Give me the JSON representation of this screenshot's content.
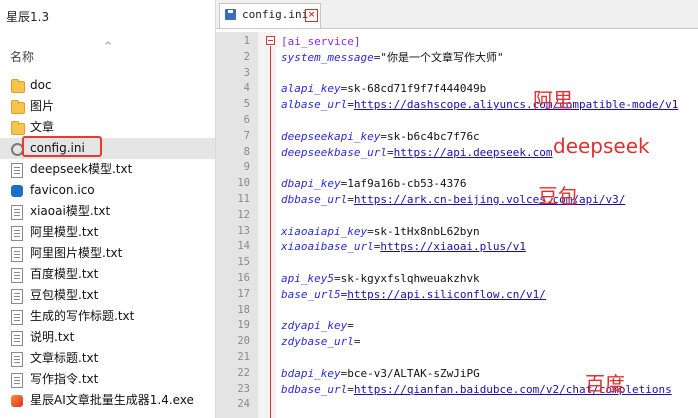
{
  "explorer": {
    "window_title": "星辰1.3",
    "column_header": "名称",
    "items": [
      {
        "name": "doc",
        "type": "folder"
      },
      {
        "name": "图片",
        "type": "folder"
      },
      {
        "name": "文章",
        "type": "folder"
      },
      {
        "name": "config.ini",
        "type": "ini",
        "selected": true
      },
      {
        "name": "deepseek模型.txt",
        "type": "txt"
      },
      {
        "name": "favicon.ico",
        "type": "ico"
      },
      {
        "name": "xiaoai模型.txt",
        "type": "txt"
      },
      {
        "name": "阿里模型.txt",
        "type": "txt"
      },
      {
        "name": "阿里图片模型.txt",
        "type": "txt"
      },
      {
        "name": "百度模型.txt",
        "type": "txt"
      },
      {
        "name": "豆包模型.txt",
        "type": "txt"
      },
      {
        "name": "生成的写作标题.txt",
        "type": "txt"
      },
      {
        "name": "说明.txt",
        "type": "txt"
      },
      {
        "name": "文章标题.txt",
        "type": "txt"
      },
      {
        "name": "写作指令.txt",
        "type": "txt"
      },
      {
        "name": "星辰AI文章批量生成器1.4.exe",
        "type": "exe"
      }
    ]
  },
  "editor": {
    "tab_title": "config.ini",
    "lines": [
      {
        "n": "1",
        "section": "[ai_service]"
      },
      {
        "n": "2",
        "key": "system_message",
        "value": "\"你是一个文章写作大师\""
      },
      {
        "n": "3"
      },
      {
        "n": "4",
        "key": "alapi_key",
        "value": "sk-68cd71f9f7f444049b"
      },
      {
        "n": "5",
        "key": "albase_url",
        "url": "https://dashscope.aliyuncs.com/compatible-mode/v1"
      },
      {
        "n": "6"
      },
      {
        "n": "7",
        "key": "deepseekapi_key",
        "value": "sk-b6c4bc7f76c"
      },
      {
        "n": "8",
        "key": "deepseekbase_url",
        "url": "https://api.deepseek.com"
      },
      {
        "n": "9"
      },
      {
        "n": "10",
        "key": "dbapi_key",
        "value": "1af9a16b-cb53-4376"
      },
      {
        "n": "11",
        "key": "dbbase_url",
        "url": "https://ark.cn-beijing.volces.com/api/v3/"
      },
      {
        "n": "12"
      },
      {
        "n": "13",
        "key": "xiaoaiapi_key",
        "value": "sk-1tHx8nbL62byn"
      },
      {
        "n": "14",
        "key": "xiaoaibase_url",
        "url": "https://xiaoai.plus/v1"
      },
      {
        "n": "15"
      },
      {
        "n": "16",
        "key": "api_key5",
        "value": "sk-kgyxfslqhweuakzhvk"
      },
      {
        "n": "17",
        "key": "base_url5",
        "url": "https://api.siliconflow.cn/v1/"
      },
      {
        "n": "18"
      },
      {
        "n": "19",
        "key": "zdyapi_key",
        "value": ""
      },
      {
        "n": "20",
        "key": "zdybase_url",
        "value": ""
      },
      {
        "n": "21"
      },
      {
        "n": "22",
        "key": "bdapi_key",
        "value": "bce-v3/ALTAK-sZwJiPG"
      },
      {
        "n": "23",
        "key": "bdbase_url",
        "url": "https://qianfan.baidubce.com/v2/chat/completions"
      },
      {
        "n": "24"
      }
    ]
  },
  "annotations": {
    "aliyun": "阿里",
    "deepseek": "deepseek",
    "doubao": "豆包",
    "baidu": "百度"
  },
  "colors": {
    "annotation_red": "#e0312f",
    "section_purple": "#8a2be2",
    "key_blue": "#2b2bd6",
    "url_blue": "#1a0dab"
  }
}
